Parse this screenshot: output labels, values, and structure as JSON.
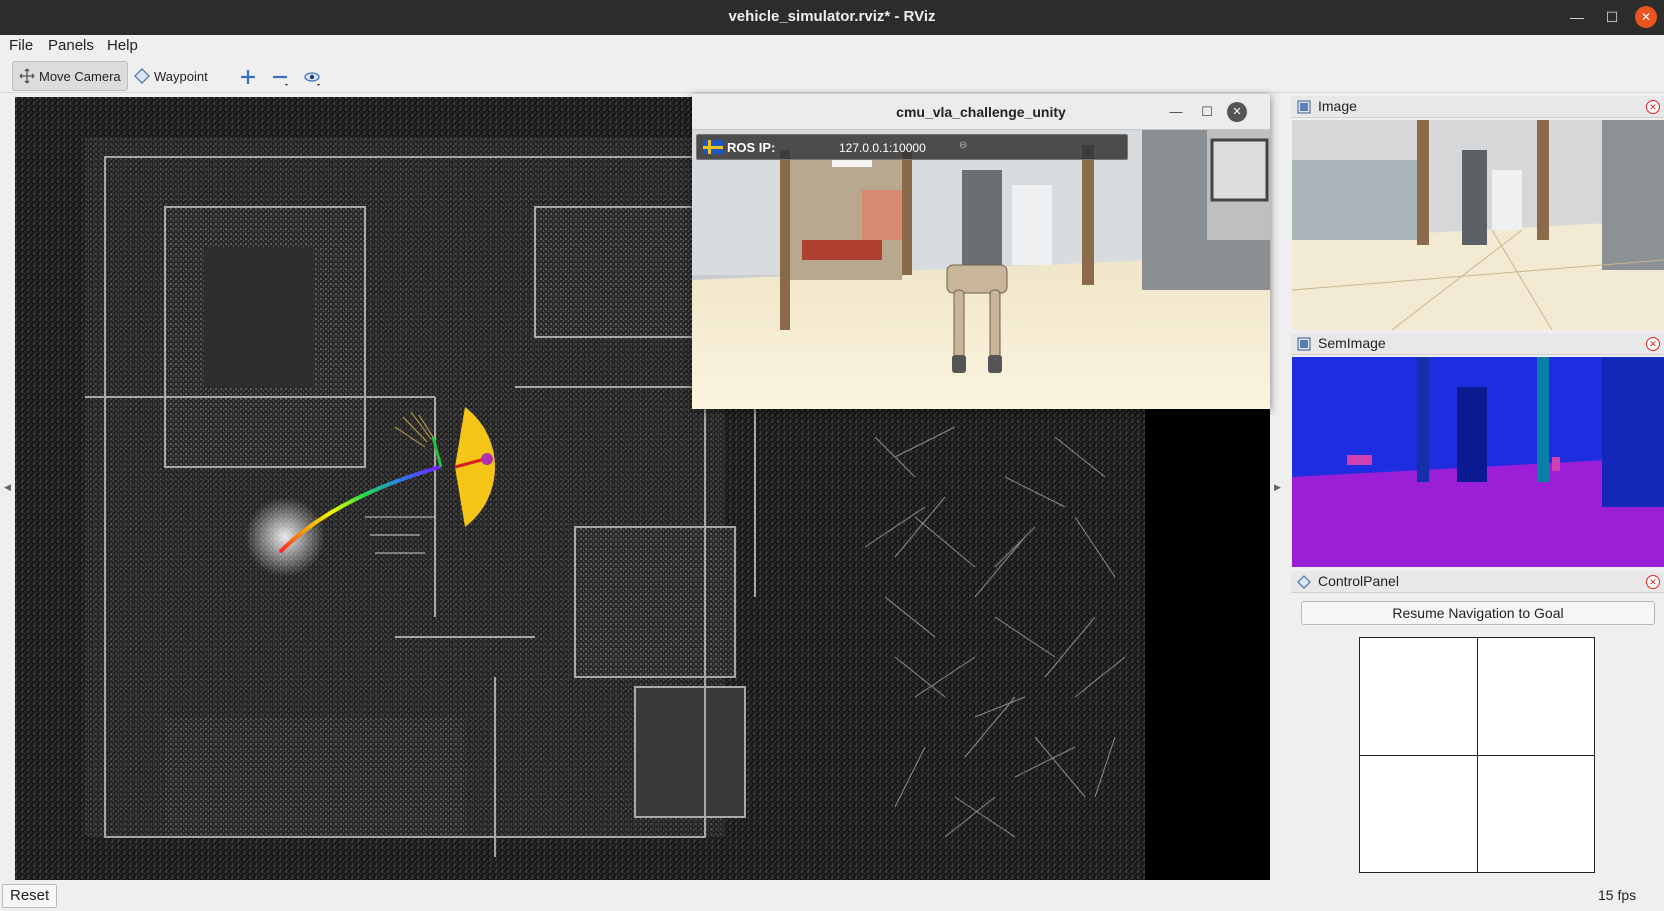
{
  "window": {
    "title": "vehicle_simulator.rviz* - RViz"
  },
  "menu": {
    "file": "File",
    "panels": "Panels",
    "help": "Help"
  },
  "toolbar": {
    "move_camera": "Move Camera",
    "waypoint": "Waypoint"
  },
  "unity": {
    "title": "cmu_vla_challenge_unity",
    "ros_ip_label": "ROS IP:",
    "ros_ip_value": "127.0.0.1:10000"
  },
  "panels": {
    "image": {
      "title": "Image"
    },
    "semimage": {
      "title": "SemImage"
    },
    "control": {
      "title": "ControlPanel",
      "resume_button": "Resume Navigation to Goal"
    }
  },
  "status": {
    "reset": "Reset",
    "fps": "15 fps"
  },
  "icons": {
    "move_camera": "move-camera-icon",
    "waypoint": "waypoint-icon",
    "add": "plus-icon",
    "remove": "minus-icon",
    "view": "eye-icon",
    "panel": "panel-icon",
    "close": "close-icon"
  },
  "colors": {
    "accent_close": "#e95420",
    "path_marker": "#f5c518",
    "seg_floor": "#9a1fd6",
    "seg_wall": "#1e2de0"
  }
}
